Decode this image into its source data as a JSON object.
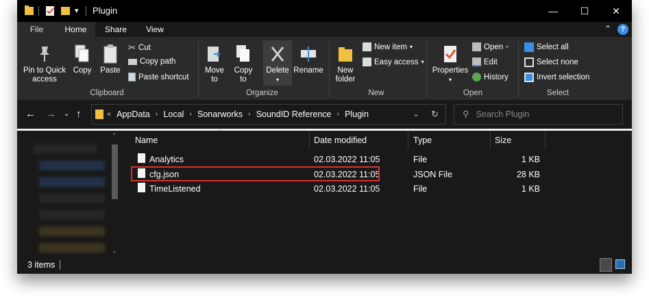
{
  "window": {
    "title": "Plugin",
    "controls": {
      "minimize": "—",
      "maximize": "☐",
      "close": "✕"
    }
  },
  "tabs": [
    {
      "label": "File"
    },
    {
      "label": "Home"
    },
    {
      "label": "Share"
    },
    {
      "label": "View"
    }
  ],
  "ribbon": {
    "clipboard": {
      "pin": "Pin to Quick access",
      "copy": "Copy",
      "paste": "Paste",
      "cut": "Cut",
      "copy_path": "Copy path",
      "paste_shortcut": "Paste shortcut",
      "group": "Clipboard"
    },
    "organize": {
      "move_to": "Move to",
      "copy_to": "Copy to",
      "delete": "Delete",
      "rename": "Rename",
      "group": "Organize"
    },
    "new": {
      "new_folder": "New folder",
      "new_item": "New item",
      "easy_access": "Easy access",
      "group": "New"
    },
    "open": {
      "properties": "Properties",
      "open": "Open",
      "edit": "Edit",
      "history": "History",
      "group": "Open"
    },
    "select": {
      "select_all": "Select all",
      "select_none": "Select none",
      "invert": "Invert selection",
      "group": "Select"
    }
  },
  "address": {
    "overflow": "«",
    "crumbs": [
      "AppData",
      "Local",
      "Sonarworks",
      "SoundID Reference",
      "Plugin"
    ],
    "search_placeholder": "Search Plugin"
  },
  "columns": {
    "name": "Name",
    "date": "Date modified",
    "type": "Type",
    "size": "Size"
  },
  "files": [
    {
      "name": "Analytics",
      "date": "02.03.2022 11:05",
      "type": "File",
      "size": "1 KB"
    },
    {
      "name": "cfg.json",
      "date": "02.03.2022 11:05",
      "type": "JSON File",
      "size": "28 KB"
    },
    {
      "name": "TimeListened",
      "date": "02.03.2022 11:05",
      "type": "File",
      "size": "1 KB"
    }
  ],
  "status": {
    "items": "3 items"
  },
  "colors": {
    "highlight": "#d9302c",
    "folder": "#f0c040",
    "accent": "#3a8ee6"
  }
}
